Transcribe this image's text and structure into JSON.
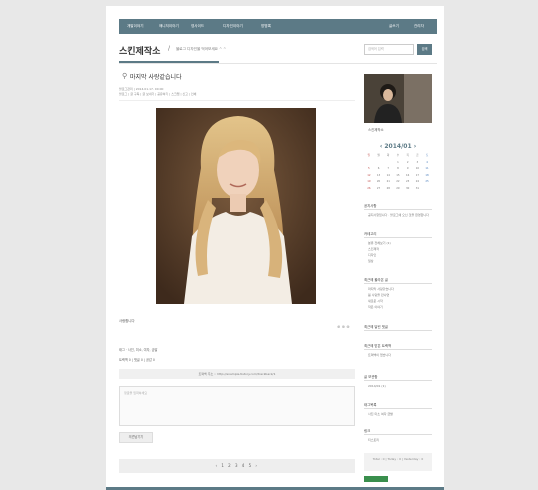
{
  "nav": {
    "items": [
      "개발이야기",
      "매니저이야기",
      "영사이드",
      "디자인이야기",
      "방명록"
    ],
    "right_items": [
      "글쓰기",
      "관리자"
    ]
  },
  "header": {
    "site_title": "스킨제작소",
    "separator": "/",
    "description": "블로그 디자인을 먹어보세요 ^ ^",
    "search_placeholder": "검색어 입력",
    "search_button": "검색"
  },
  "post": {
    "title": "마지막 사랑같습니다",
    "meta_line1": "블로그관리 | 2014.01.17. 00:00",
    "meta_line2": "블로그 | 글 구독 | 글 보내기 | 공유하기 | 스크랩 | 신고 | 인쇄",
    "body_text": "사랑합니다",
    "share_icons": "⊕ ⊕ ⊕",
    "tag_line": "태그 · 사진, 미소, 여자, 금발",
    "tag_line2": "트랙백 0 | 댓글 0 | 공감 0",
    "trackback_text": "트랙백 주소 :: http://example.tistory.com/trackback/1",
    "comment_placeholder": "댓글을 입력하세요",
    "comment_button": "의견남기기",
    "pager": "‹ 1 2 3 4 5 ›"
  },
  "sidebar": {
    "profile_name": "스킨제작소",
    "calendar_title": "‹   2014/01   ›",
    "calendar_cells": [
      "일",
      "월",
      "화",
      "수",
      "목",
      "금",
      "토",
      "",
      "",
      "",
      "1",
      "2",
      "3",
      "4",
      "5",
      "6",
      "7",
      "8",
      "9",
      "10",
      "11",
      "12",
      "13",
      "14",
      "15",
      "16",
      "17",
      "18",
      "19",
      "20",
      "21",
      "22",
      "23",
      "24",
      "25",
      "26",
      "27",
      "28",
      "29",
      "30",
      "31",
      ""
    ],
    "notice_title": "공지사항",
    "notice_item": "공지사항입니다 · 블로그에 오신 것을 환영합니다",
    "category_title": "카테고리",
    "category_items": [
      "분류 전체보기 (1)",
      "스킨제작",
      "디자인",
      "일상"
    ],
    "recent_title": "최근에 올라온 글",
    "recent_items": [
      "마지막 사랑같습니다",
      "봄 사랑을 만나면",
      "새로운 시작",
      "작은 이야기"
    ],
    "recent_comments_title": "최근에 달린 댓글",
    "trackback_title": "최근에 받은 트랙백",
    "trackback_items": [
      "트랙백이 없습니다"
    ],
    "archive_title": "글 보관함",
    "archive_items": [
      "2014/01 (1)"
    ],
    "tags_title": "태그목록",
    "tags_text": "사진 미소 여자 금발",
    "link_title": "링크",
    "link_item": "티스토리",
    "counter_text": "Total : 0 | Today : 0 | Yesterday : 0"
  },
  "colors": {
    "accent": "#5c7a86",
    "page_bg": "#e8e8e8"
  }
}
